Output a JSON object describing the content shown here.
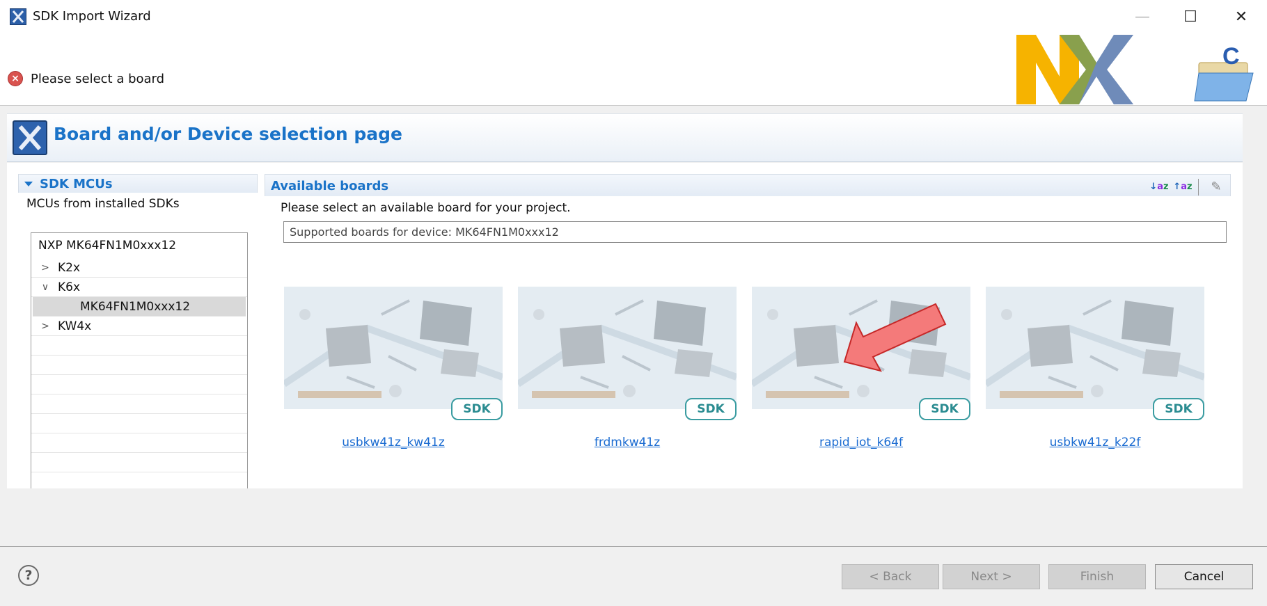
{
  "window": {
    "title": "SDK Import Wizard",
    "controls": {
      "minimize": "—",
      "maximize": "☐",
      "close": "✕"
    }
  },
  "banner": {
    "message": "Please select a board",
    "icon": "error-icon",
    "logo_text": "NXP"
  },
  "page": {
    "title": "Board and/or Device selection page"
  },
  "left_panel": {
    "header": "SDK MCUs",
    "subtitle": "MCUs from installed SDKs",
    "tree": {
      "root": "NXP MK64FN1M0xxx12",
      "items": [
        {
          "label": "K2x",
          "expanded": false
        },
        {
          "label": "K6x",
          "expanded": true
        },
        {
          "label": "MK64FN1M0xxx12",
          "selected": true
        },
        {
          "label": "KW4x",
          "expanded": false
        }
      ]
    }
  },
  "right_panel": {
    "header": "Available boards",
    "instruction": "Please select an available board for your project.",
    "filter_value": "Supported boards for device: MK64FN1M0xxx12",
    "boards": [
      {
        "name": "usbkw41z_kw41z",
        "badge": "SDK"
      },
      {
        "name": "frdmkw41z",
        "badge": "SDK"
      },
      {
        "name": "rapid_iot_k64f",
        "badge": "SDK"
      },
      {
        "name": "usbkw41z_k22f",
        "badge": "SDK"
      }
    ]
  },
  "footer": {
    "help": "?",
    "back": "< Back",
    "next": "Next >",
    "finish": "Finish",
    "cancel": "Cancel"
  },
  "colors": {
    "accent_blue": "#1a73c8",
    "link_blue": "#1a6bd1",
    "sdk_teal": "#3a9ca1",
    "arrow_red": "#f47a7a"
  }
}
